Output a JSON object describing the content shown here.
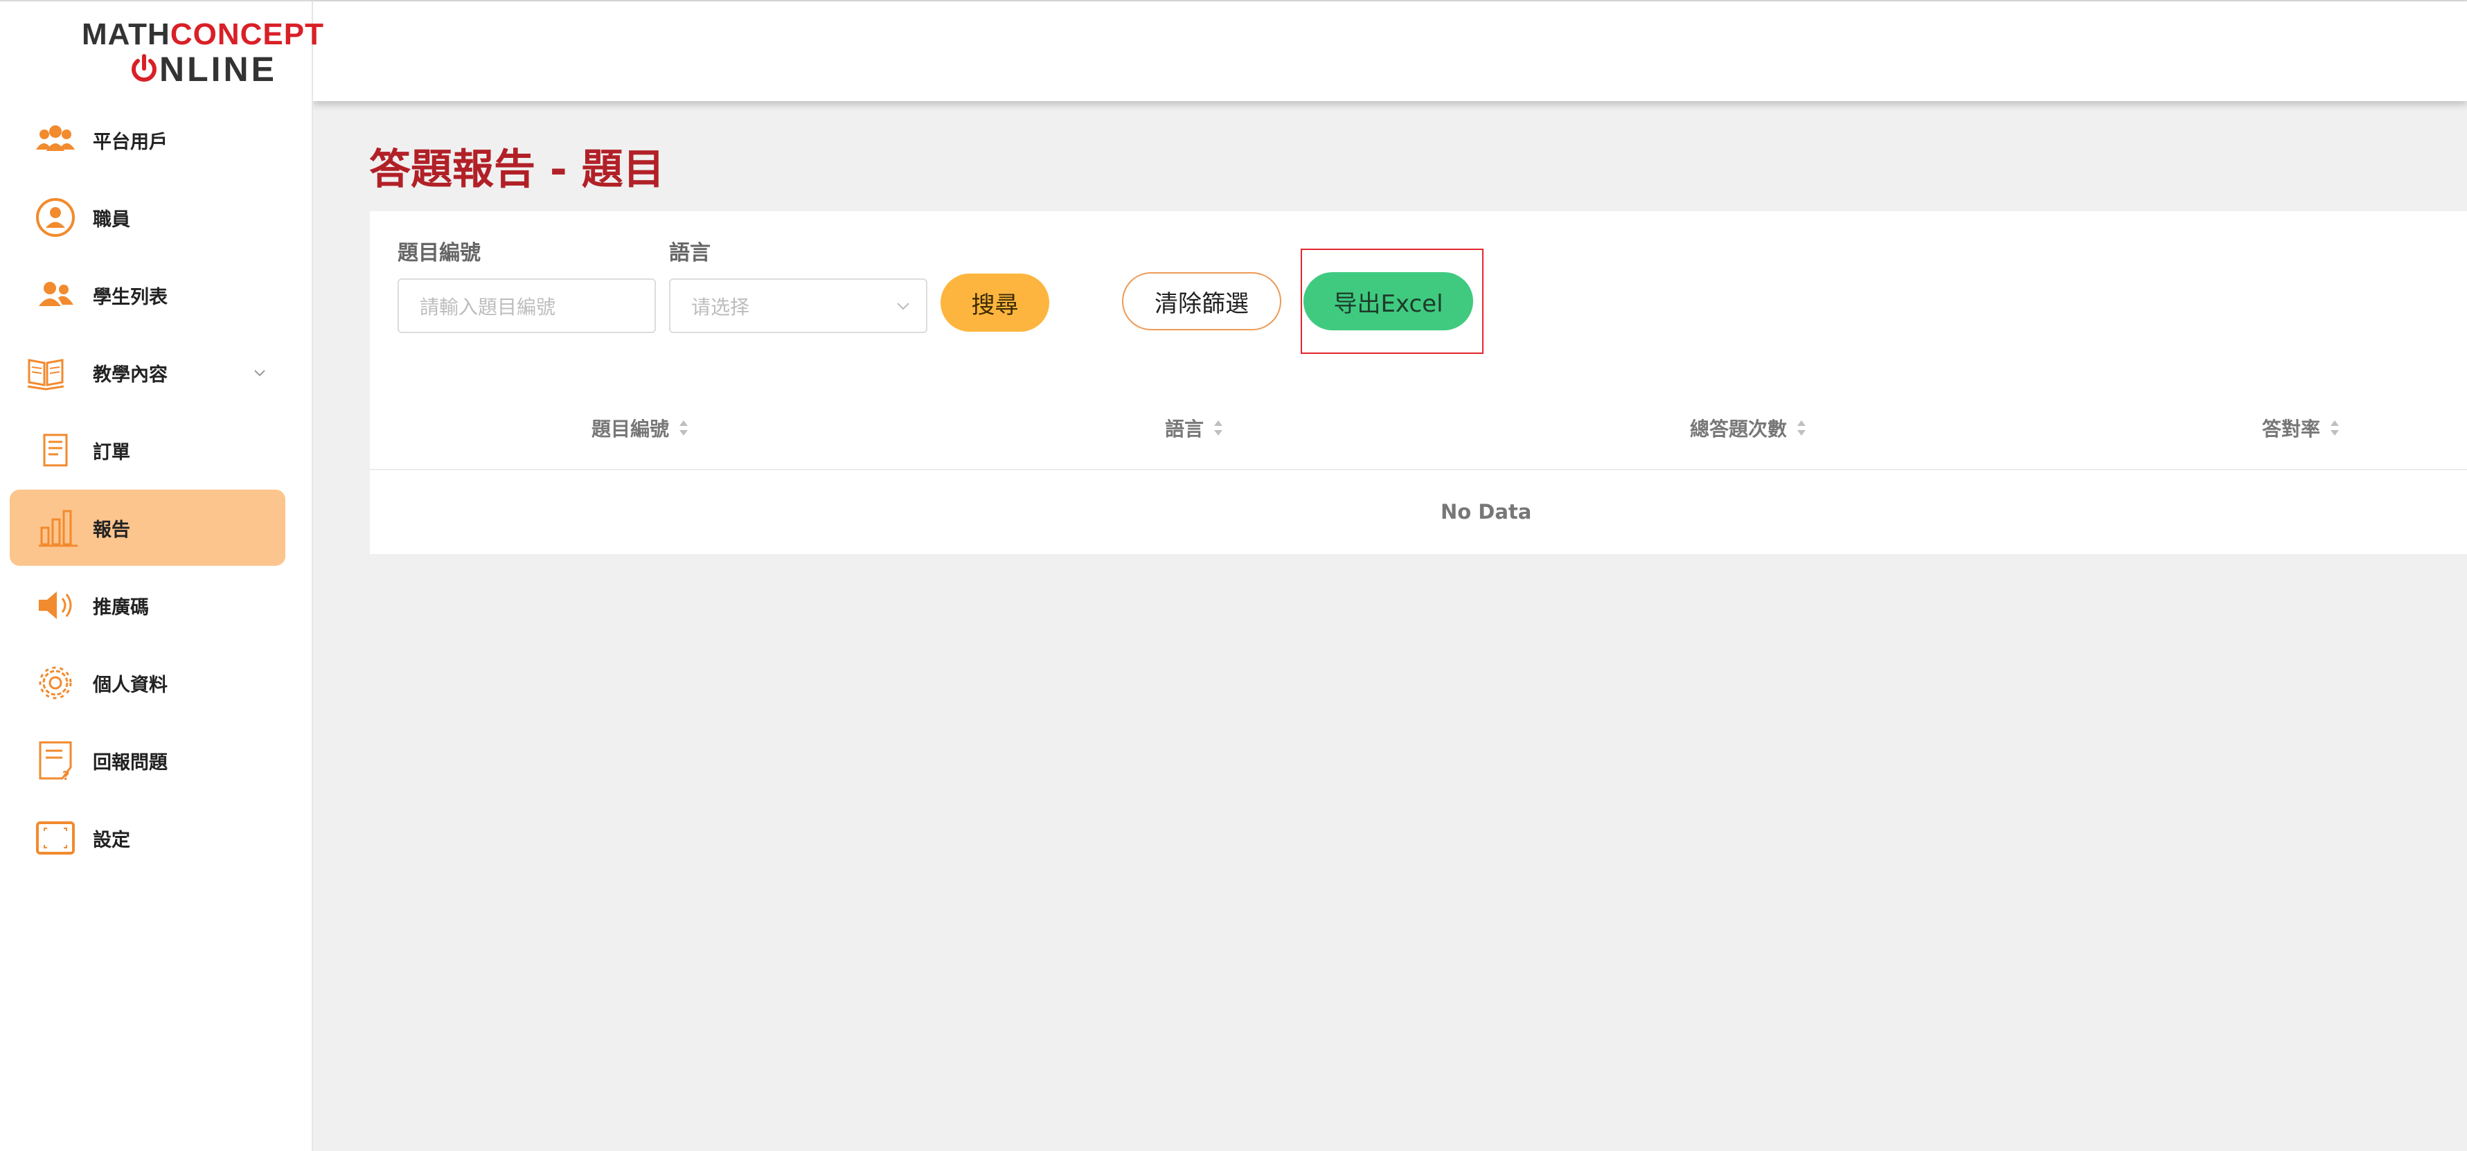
{
  "logo": {
    "line1_part1": "MATH",
    "line1_part2": "CONCEPT",
    "line2": "NLINE"
  },
  "sidebar": {
    "items": [
      {
        "label": "平台用戶",
        "icon": "users-group-icon"
      },
      {
        "label": "職員",
        "icon": "user-circle-icon"
      },
      {
        "label": "學生列表",
        "icon": "students-icon"
      },
      {
        "label": "教學內容",
        "icon": "book-icon",
        "expandable": true
      },
      {
        "label": "訂單",
        "icon": "receipt-icon"
      },
      {
        "label": "報告",
        "icon": "bar-chart-icon",
        "active": true
      },
      {
        "label": "推廣碼",
        "icon": "megaphone-icon"
      },
      {
        "label": "個人資料",
        "icon": "gear-icon"
      },
      {
        "label": "回報問題",
        "icon": "report-question-icon"
      },
      {
        "label": "設定",
        "icon": "settings-frame-icon"
      }
    ]
  },
  "page": {
    "title": "答題報告 - 題目"
  },
  "filters": {
    "question_id": {
      "label": "題目編號",
      "placeholder": "請輸入題目編號"
    },
    "language": {
      "label": "語言",
      "placeholder": "请选择"
    }
  },
  "buttons": {
    "search": "搜尋",
    "clear": "清除篩選",
    "export": "导出Excel"
  },
  "table": {
    "headers": [
      "題目編號",
      "語言",
      "總答題次數",
      "答對率"
    ],
    "empty_text": "No Data"
  },
  "colors": {
    "accent_orange": "#f28a2e",
    "active_bg": "#fcc58e",
    "title_red": "#b22027",
    "export_green": "#3fca80",
    "search_yellow": "#fdb53f",
    "highlight_red": "#e5262d"
  }
}
